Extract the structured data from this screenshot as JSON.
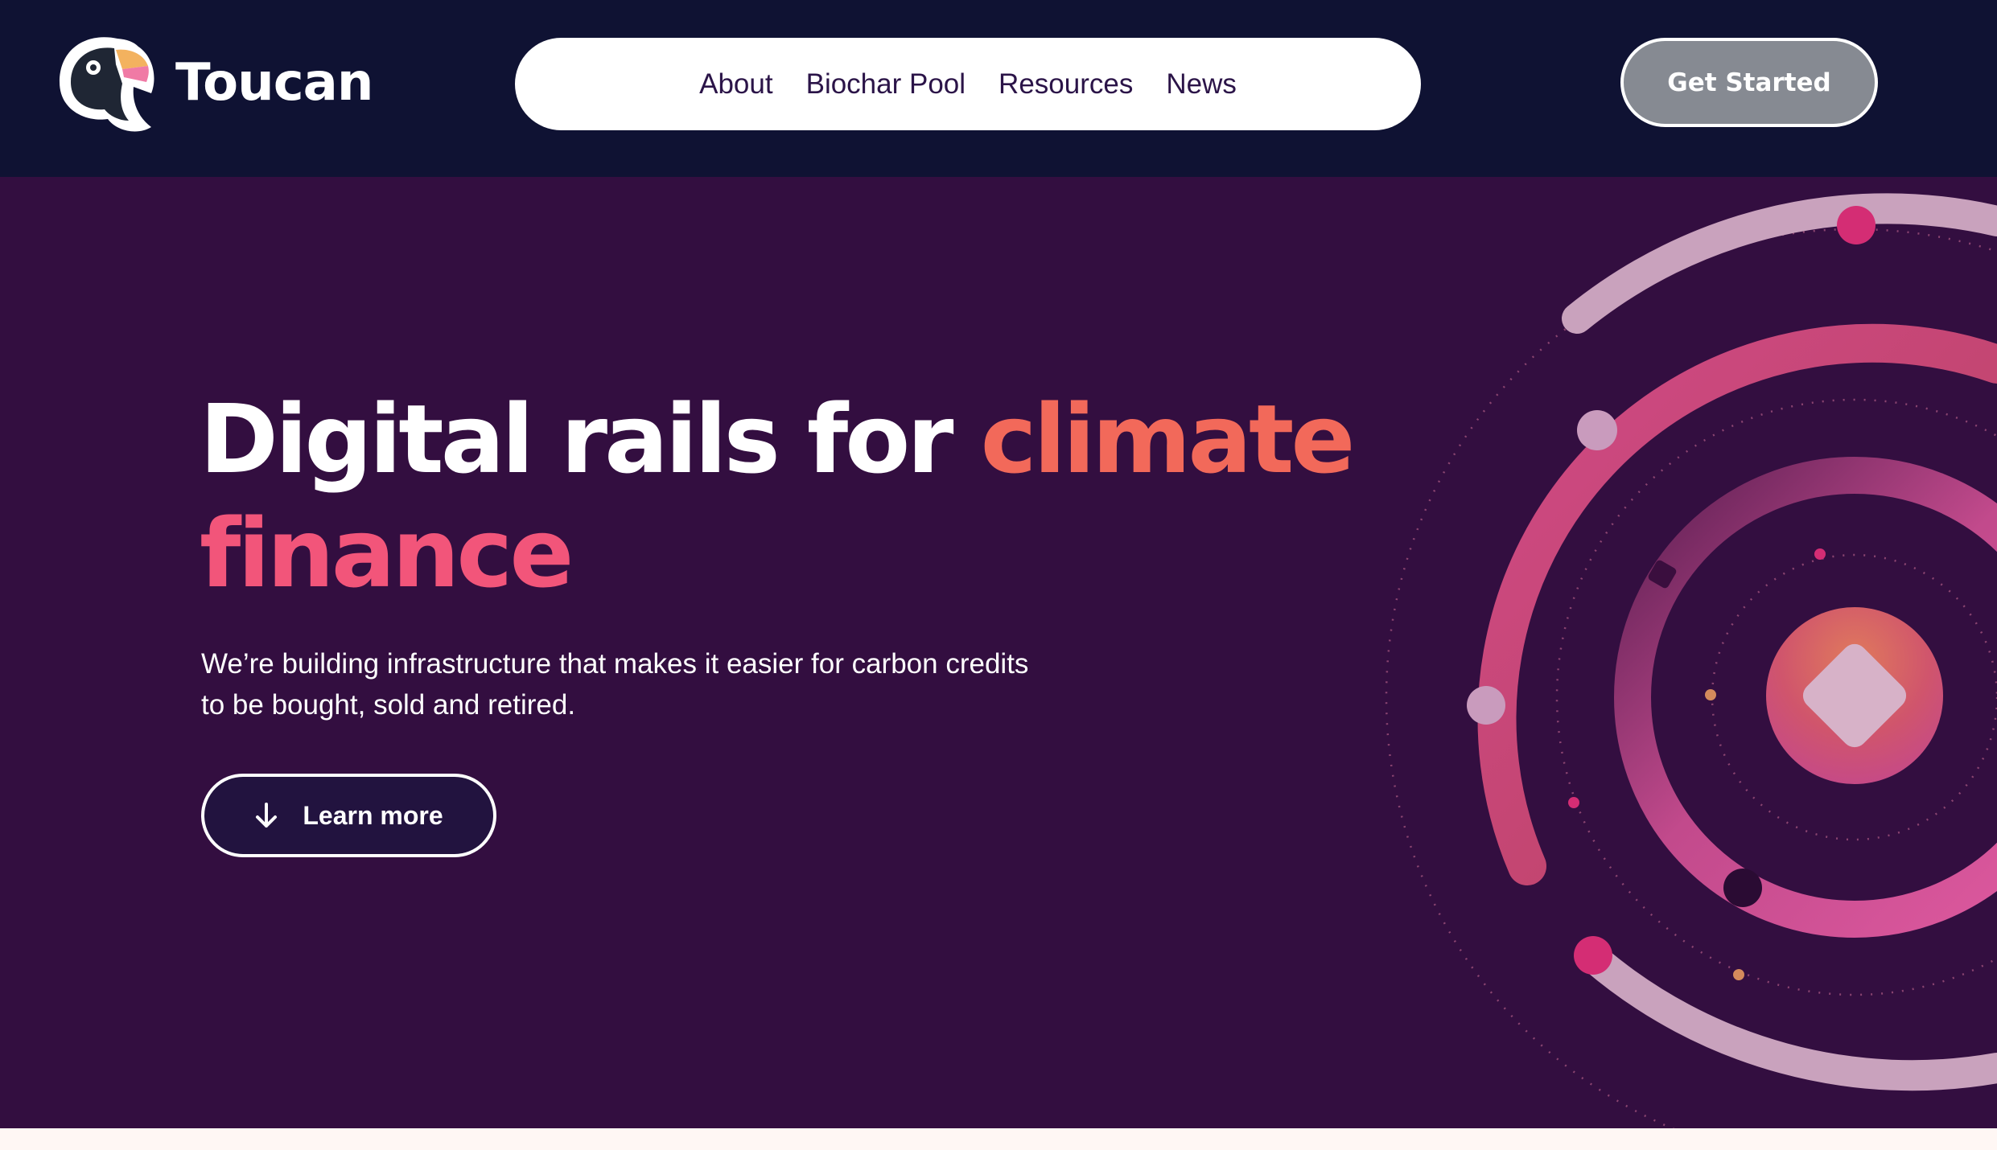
{
  "header": {
    "brand": "Toucan",
    "logo_icon": "toucan-logo-icon",
    "nav": [
      {
        "label": "About"
      },
      {
        "label": "Biochar Pool"
      },
      {
        "label": "Resources"
      },
      {
        "label": "News"
      }
    ],
    "cta_label": "Get Started"
  },
  "hero": {
    "title_white": "Digital rails for ",
    "title_accent_1": "climate",
    "title_accent_2": "finance",
    "subtitle": "We’re building infrastructure that makes it easier for carbon credits to be bought, sold and retired.",
    "learn_more_label": "Learn more",
    "learn_more_icon": "arrow-down-icon"
  },
  "colors": {
    "header_bg": "#0f1233",
    "hero_bg": "#330e40",
    "accent_coral": "#f2695a",
    "accent_pink": "#f2557a",
    "cta_bg": "#868a92",
    "nav_text": "#2b1448"
  }
}
